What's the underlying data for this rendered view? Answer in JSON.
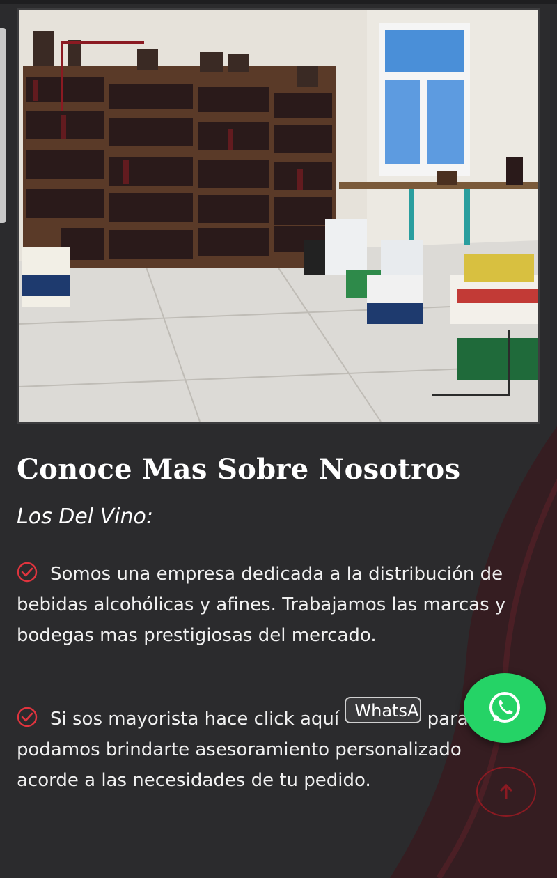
{
  "about": {
    "title": "Conoce Mas Sobre Nosotros",
    "subtitle": "Los Del Vino:",
    "items": [
      {
        "text": "Somos una empresa dedicada a la distribución de bebidas alcohólicas y afines. Trabajamos las marcas y bodegas mas prestigiosas del mercado."
      },
      {
        "text_before": "Si sos mayorista hace click aquí",
        "button_label": "WhatsApp",
        "text_after": "para que podamos brindarte asesoramiento personalizado acorde a las necesidades de tu pedido."
      }
    ]
  },
  "hero": {
    "alt": "store interior"
  },
  "colors": {
    "background": "#2b2b2d",
    "accent": "#8b1a22",
    "check": "#e0343e",
    "whatsapp": "#25d366"
  },
  "icons": {
    "check": "check-circle-icon",
    "whatsapp": "whatsapp-icon",
    "scroll_top": "arrow-up-icon"
  }
}
